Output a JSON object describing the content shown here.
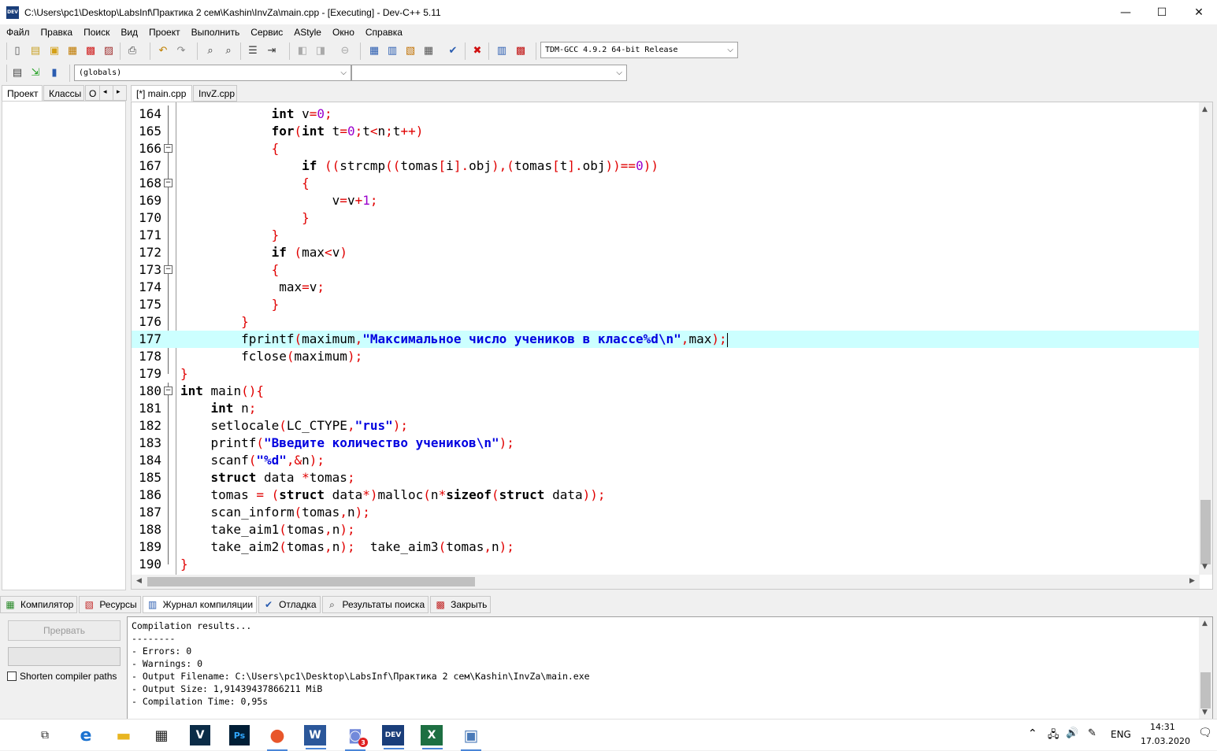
{
  "window": {
    "title": "C:\\Users\\pc1\\Desktop\\LabsInf\\Практика 2 сем\\Kashin\\InvZa\\main.cpp - [Executing] - Dev-C++ 5.11",
    "app_icon_text": "DEV",
    "minimize": "—",
    "maximize": "☐",
    "close": "✕"
  },
  "menu": [
    "Файл",
    "Правка",
    "Поиск",
    "Вид",
    "Проект",
    "Выполнить",
    "Сервис",
    "AStyle",
    "Окно",
    "Справка"
  ],
  "toolbar": {
    "compiler_select": "TDM-GCC 4.9.2 64-bit Release",
    "scope_select": "(globals)",
    "function_select": ""
  },
  "left_tabs": [
    "Проект",
    "Классы",
    "О"
  ],
  "editor_tabs": [
    "[*] main.cpp",
    "InvZ.cpp"
  ],
  "code": [
    {
      "n": "164",
      "tokens": [
        [
          "            ",
          ""
        ],
        [
          "int",
          "kw"
        ],
        [
          " v",
          ""
        ],
        [
          "=",
          "sym"
        ],
        [
          "0",
          "num"
        ],
        [
          ";",
          "sym"
        ]
      ]
    },
    {
      "n": "165",
      "tokens": [
        [
          "            ",
          ""
        ],
        [
          "for",
          "kw"
        ],
        [
          "(",
          "sym"
        ],
        [
          "int",
          "kw"
        ],
        [
          " t",
          ""
        ],
        [
          "=",
          "sym"
        ],
        [
          "0",
          "num"
        ],
        [
          ";",
          "sym"
        ],
        [
          "t",
          ""
        ],
        [
          "<",
          "sym"
        ],
        [
          "n",
          ""
        ],
        [
          ";",
          "sym"
        ],
        [
          "t",
          ""
        ],
        [
          "++",
          "sym"
        ],
        [
          ")",
          "sym"
        ]
      ]
    },
    {
      "n": "166",
      "fold": true,
      "tokens": [
        [
          "            ",
          ""
        ],
        [
          "{",
          "sym"
        ]
      ]
    },
    {
      "n": "167",
      "tokens": [
        [
          "                ",
          ""
        ],
        [
          "if",
          "kw"
        ],
        [
          " ",
          ""
        ],
        [
          "((",
          "sym"
        ],
        [
          "strcmp",
          ""
        ],
        [
          "((",
          "sym"
        ],
        [
          "tomas",
          ""
        ],
        [
          "[",
          "sym"
        ],
        [
          "i",
          ""
        ],
        [
          "].",
          "sym"
        ],
        [
          "obj",
          ""
        ],
        [
          ")",
          "sym"
        ],
        [
          ",",
          "sym"
        ],
        [
          "(",
          "sym"
        ],
        [
          "tomas",
          ""
        ],
        [
          "[",
          "sym"
        ],
        [
          "t",
          ""
        ],
        [
          "].",
          "sym"
        ],
        [
          "obj",
          ""
        ],
        [
          "))==",
          "sym"
        ],
        [
          "0",
          "num"
        ],
        [
          "))",
          "sym"
        ]
      ]
    },
    {
      "n": "168",
      "fold": true,
      "tokens": [
        [
          "                ",
          ""
        ],
        [
          "{",
          "sym"
        ]
      ]
    },
    {
      "n": "169",
      "tokens": [
        [
          "                    ",
          ""
        ],
        [
          "v",
          ""
        ],
        [
          "=",
          "sym"
        ],
        [
          "v",
          ""
        ],
        [
          "+",
          "sym"
        ],
        [
          "1",
          "num"
        ],
        [
          ";",
          "sym"
        ]
      ]
    },
    {
      "n": "170",
      "tokens": [
        [
          "                ",
          ""
        ],
        [
          "}",
          "sym"
        ]
      ]
    },
    {
      "n": "171",
      "tokens": [
        [
          "            ",
          ""
        ],
        [
          "}",
          "sym"
        ]
      ]
    },
    {
      "n": "172",
      "tokens": [
        [
          "            ",
          ""
        ],
        [
          "if",
          "kw"
        ],
        [
          " ",
          ""
        ],
        [
          "(",
          "sym"
        ],
        [
          "max",
          ""
        ],
        [
          "<",
          "sym"
        ],
        [
          "v",
          ""
        ],
        [
          ")",
          "sym"
        ]
      ]
    },
    {
      "n": "173",
      "fold": true,
      "tokens": [
        [
          "            ",
          ""
        ],
        [
          "{",
          "sym"
        ]
      ]
    },
    {
      "n": "174",
      "tokens": [
        [
          "             ",
          ""
        ],
        [
          "max",
          ""
        ],
        [
          "=",
          "sym"
        ],
        [
          "v",
          ""
        ],
        [
          ";",
          "sym"
        ]
      ]
    },
    {
      "n": "175",
      "tokens": [
        [
          "            ",
          ""
        ],
        [
          "}",
          "sym"
        ]
      ]
    },
    {
      "n": "176",
      "tokens": [
        [
          "        ",
          ""
        ],
        [
          "}",
          "sym"
        ]
      ]
    },
    {
      "n": "177",
      "highlight": true,
      "tokens": [
        [
          "        ",
          ""
        ],
        [
          "fprintf",
          ""
        ],
        [
          "(",
          "sym"
        ],
        [
          "maximum",
          ""
        ],
        [
          ",",
          "sym"
        ],
        [
          "\"Максимальное число учеников в классе%d\\n\"",
          "str"
        ],
        [
          ",",
          "sym"
        ],
        [
          "max",
          ""
        ],
        [
          ");",
          "sym"
        ]
      ]
    },
    {
      "n": "178",
      "tokens": [
        [
          "        ",
          ""
        ],
        [
          "fclose",
          ""
        ],
        [
          "(",
          "sym"
        ],
        [
          "maximum",
          ""
        ],
        [
          ");",
          "sym"
        ]
      ]
    },
    {
      "n": "179",
      "tokens": [
        [
          "",
          ""
        ],
        [
          "}",
          "sym"
        ]
      ]
    },
    {
      "n": "180",
      "fold": true,
      "tokens": [
        [
          "int",
          "kw"
        ],
        [
          " main",
          ""
        ],
        [
          "(){",
          "sym"
        ]
      ]
    },
    {
      "n": "181",
      "tokens": [
        [
          "    ",
          ""
        ],
        [
          "int",
          "kw"
        ],
        [
          " n",
          ""
        ],
        [
          ";",
          "sym"
        ]
      ]
    },
    {
      "n": "182",
      "tokens": [
        [
          "    ",
          ""
        ],
        [
          "setlocale",
          ""
        ],
        [
          "(",
          "sym"
        ],
        [
          "LC_CTYPE",
          ""
        ],
        [
          ",",
          "sym"
        ],
        [
          "\"rus\"",
          "str"
        ],
        [
          ");",
          "sym"
        ]
      ]
    },
    {
      "n": "183",
      "tokens": [
        [
          "    ",
          ""
        ],
        [
          "printf",
          ""
        ],
        [
          "(",
          "sym"
        ],
        [
          "\"Введите количество учеников\\n\"",
          "str"
        ],
        [
          ");",
          "sym"
        ]
      ]
    },
    {
      "n": "184",
      "tokens": [
        [
          "    ",
          ""
        ],
        [
          "scanf",
          ""
        ],
        [
          "(",
          "sym"
        ],
        [
          "\"%d\"",
          "str"
        ],
        [
          ",&",
          "sym"
        ],
        [
          "n",
          ""
        ],
        [
          ");",
          "sym"
        ]
      ]
    },
    {
      "n": "185",
      "tokens": [
        [
          "    ",
          ""
        ],
        [
          "struct",
          "kw"
        ],
        [
          " data ",
          ""
        ],
        [
          "*",
          "sym"
        ],
        [
          "tomas",
          ""
        ],
        [
          ";",
          "sym"
        ]
      ]
    },
    {
      "n": "186",
      "tokens": [
        [
          "    ",
          ""
        ],
        [
          "tomas ",
          ""
        ],
        [
          "=",
          "sym"
        ],
        [
          " ",
          ""
        ],
        [
          "(",
          "sym"
        ],
        [
          "struct",
          "kw"
        ],
        [
          " data",
          ""
        ],
        [
          "*)",
          "sym"
        ],
        [
          "malloc",
          ""
        ],
        [
          "(",
          "sym"
        ],
        [
          "n",
          ""
        ],
        [
          "*",
          "sym"
        ],
        [
          "sizeof",
          "kw"
        ],
        [
          "(",
          "sym"
        ],
        [
          "struct",
          "kw"
        ],
        [
          " data",
          ""
        ],
        [
          "));",
          "sym"
        ]
      ]
    },
    {
      "n": "187",
      "tokens": [
        [
          "    ",
          ""
        ],
        [
          "scan_inform",
          ""
        ],
        [
          "(",
          "sym"
        ],
        [
          "tomas",
          ""
        ],
        [
          ",",
          "sym"
        ],
        [
          "n",
          ""
        ],
        [
          ");",
          "sym"
        ]
      ]
    },
    {
      "n": "188",
      "tokens": [
        [
          "    ",
          ""
        ],
        [
          "take_aim1",
          ""
        ],
        [
          "(",
          "sym"
        ],
        [
          "tomas",
          ""
        ],
        [
          ",",
          "sym"
        ],
        [
          "n",
          ""
        ],
        [
          ");",
          "sym"
        ]
      ]
    },
    {
      "n": "189",
      "tokens": [
        [
          "    ",
          ""
        ],
        [
          "take_aim2",
          ""
        ],
        [
          "(",
          "sym"
        ],
        [
          "tomas",
          ""
        ],
        [
          ",",
          "sym"
        ],
        [
          "n",
          ""
        ],
        [
          ");",
          "sym"
        ],
        [
          "  take_aim3",
          ""
        ],
        [
          "(",
          "sym"
        ],
        [
          "tomas",
          ""
        ],
        [
          ",",
          "sym"
        ],
        [
          "n",
          ""
        ],
        [
          ");",
          "sym"
        ]
      ]
    },
    {
      "n": "190",
      "tokens": [
        [
          "",
          ""
        ],
        [
          "}",
          "sym"
        ]
      ]
    }
  ],
  "bottom_tabs": [
    {
      "label": "Компилятор",
      "icon": "compiler-icon"
    },
    {
      "label": "Ресурсы",
      "icon": "resources-icon"
    },
    {
      "label": "Журнал компиляции",
      "icon": "compile-log-icon"
    },
    {
      "label": "Отладка",
      "icon": "debug-icon"
    },
    {
      "label": "Результаты поиска",
      "icon": "search-results-icon"
    },
    {
      "label": "Закрыть",
      "icon": "close-panel-icon"
    }
  ],
  "bottom_panel": {
    "abort_label": "Прервать",
    "shorten_label": "Shorten compiler paths",
    "log": [
      "Compilation results...",
      "--------",
      "- Errors: 0",
      "- Warnings: 0",
      "- Output Filename: C:\\Users\\pc1\\Desktop\\LabsInf\\Практика 2 сем\\Kashin\\InvZa\\main.exe",
      "- Output Size: 1,91439437866211 MiB",
      "- Compilation Time: 0,95s"
    ]
  },
  "taskbar": {
    "lang": "ENG",
    "time": "14:31",
    "date": "17.03.2020",
    "discord_badge": "3"
  },
  "colors": {
    "keyword": "#000000",
    "symbol": "#e00000",
    "number": "#9900cc",
    "string": "#0000e0",
    "highlight_line": "#ccffff"
  }
}
